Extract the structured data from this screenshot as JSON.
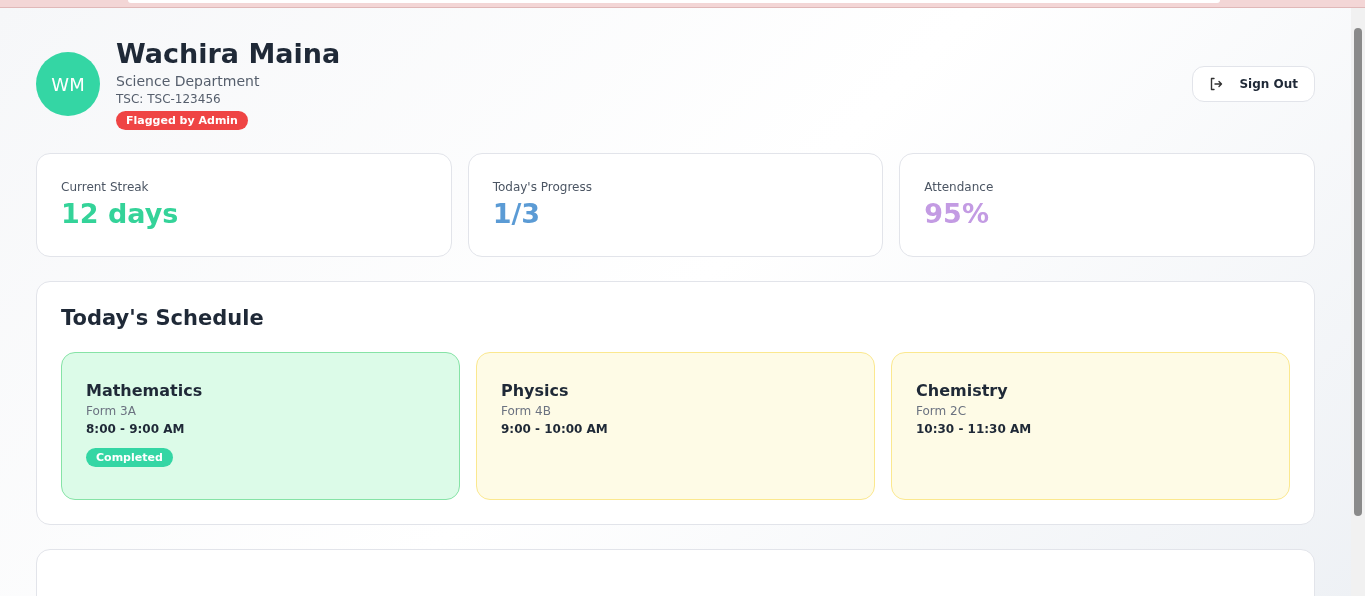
{
  "profile": {
    "initials": "WM",
    "name": "Wachira Maina",
    "department": "Science Department",
    "tsc": "TSC: TSC-123456",
    "flag": "Flagged by Admin"
  },
  "sign_out": {
    "label": "Sign Out"
  },
  "stats": [
    {
      "label": "Current Streak",
      "value": "12 days",
      "color": "#34d399"
    },
    {
      "label": "Today's Progress",
      "value": "1/3",
      "color": "#5b9bd5"
    },
    {
      "label": "Attendance",
      "value": "95%",
      "color": "#c39be3"
    }
  ],
  "schedule": {
    "title": "Today's Schedule",
    "classes": [
      {
        "subject": "Mathematics",
        "form": "Form 3A",
        "time": "8:00 - 9:00 AM",
        "completed": true,
        "badge": "Completed"
      },
      {
        "subject": "Physics",
        "form": "Form 4B",
        "time": "9:00 - 10:00 AM",
        "completed": false
      },
      {
        "subject": "Chemistry",
        "form": "Form 2C",
        "time": "10:30 - 11:30 AM",
        "completed": false
      }
    ]
  }
}
